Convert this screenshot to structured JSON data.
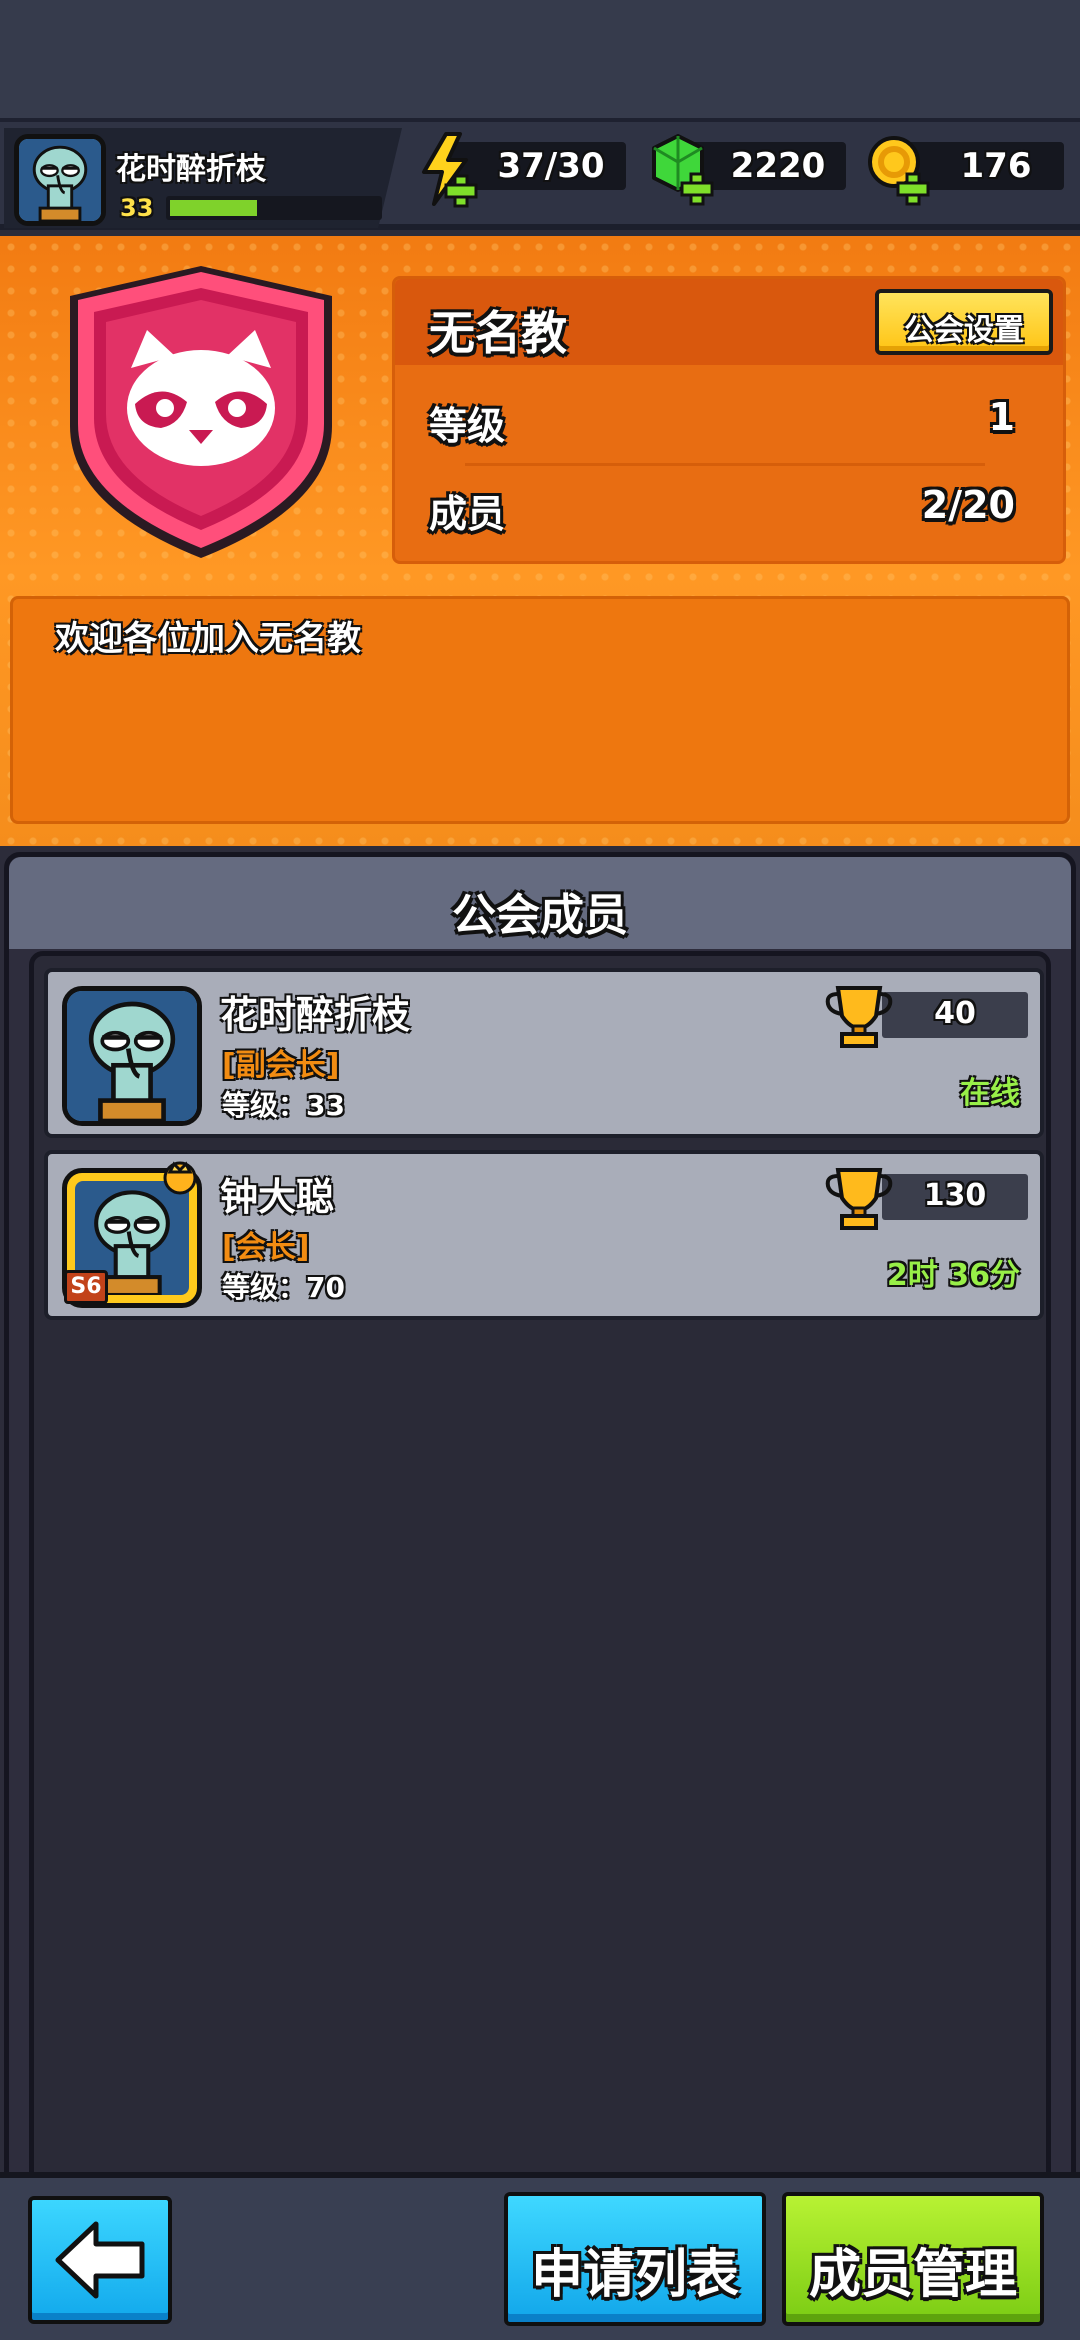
{
  "player": {
    "name": "花时醉折枝",
    "level": "33",
    "xp_fraction": 0.42
  },
  "resources": {
    "energy": "37/30",
    "gems": "2220",
    "coins": "176"
  },
  "guild": {
    "name": "无名教",
    "settings_label": "公会设置",
    "level_label": "等级",
    "level_value": "1",
    "members_label": "成员",
    "members_value": "2/20",
    "description": "欢迎各位加入无名教",
    "emblem": "raccoon-emblem"
  },
  "members_title": "公会成员",
  "members": [
    {
      "name": "花时醉折枝",
      "role": "[副会长]",
      "level": "等级：33",
      "trophies": "40",
      "status": "在线"
    },
    {
      "name": "钟大聪",
      "role": "[会长]",
      "level": "等级：70",
      "trophies": "130",
      "status": "2时 36分",
      "badge": "S6"
    }
  ],
  "buttons": {
    "apply_list": "申请列表",
    "member_manage": "成员管理"
  },
  "colors": {
    "accent_orange": "#f27b12",
    "online_green": "#98ef48",
    "role_orange": "#f28c12",
    "blue_button": "#12a9ec",
    "green_button": "#7bcc14"
  }
}
